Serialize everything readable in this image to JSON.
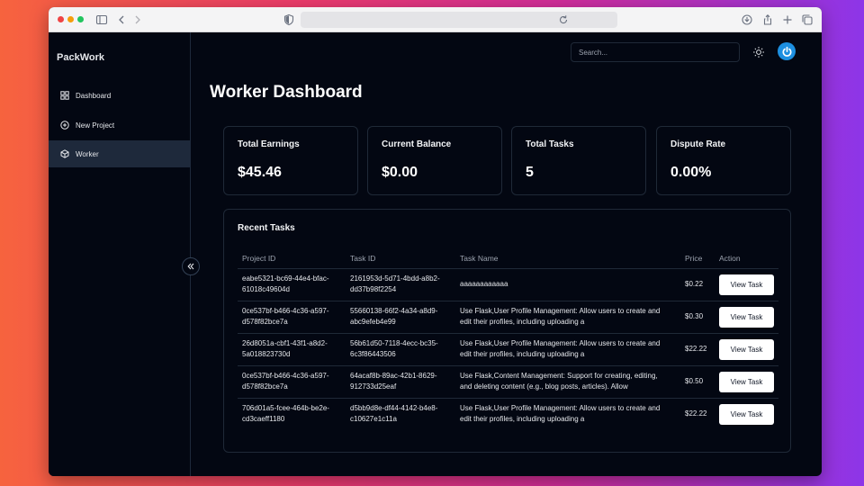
{
  "app": {
    "brand": "PackWork"
  },
  "browser": {
    "traffic_colors": [
      "#ef4444",
      "#f59e0b",
      "#22c55e"
    ],
    "url": ""
  },
  "sidebar": {
    "items": [
      {
        "label": "Dashboard",
        "icon": "grid-icon",
        "active": false
      },
      {
        "label": "New Project",
        "icon": "plus-circle-icon",
        "active": false
      },
      {
        "label": "Worker",
        "icon": "cube-icon",
        "active": true
      }
    ]
  },
  "header": {
    "search_placeholder": "Search...",
    "theme_icon": "sun-icon",
    "avatar_icon": "power-icon",
    "avatar_color": "#1d8fe0"
  },
  "main": {
    "title": "Worker Dashboard",
    "stats": [
      {
        "label": "Total Earnings",
        "value": "$45.46"
      },
      {
        "label": "Current Balance",
        "value": "$0.00"
      },
      {
        "label": "Total Tasks",
        "value": "5"
      },
      {
        "label": "Dispute Rate",
        "value": "0.00%"
      }
    ],
    "recent_tasks": {
      "title": "Recent Tasks",
      "columns": [
        "Project ID",
        "Task ID",
        "Task Name",
        "Price",
        "Action"
      ],
      "action_label": "View Task",
      "rows": [
        {
          "project_id": "eabe5321-bc69-44e4-bfac-61018c49604d",
          "task_id": "2161953d-5d71-4bdd-a8b2-dd37b98f2254",
          "task_name": "aaaaaaaaaaaa",
          "price": "$0.22"
        },
        {
          "project_id": "0ce537bf-b466-4c36-a597-d578f82bce7a",
          "task_id": "55660138-66f2-4a34-a8d9-abc9efeb4e99",
          "task_name": "Use Flask,User Profile Management: Allow users to create and edit their profiles, including uploading a",
          "price": "$0.30"
        },
        {
          "project_id": "26d8051a-cbf1-43f1-a8d2-5a018823730d",
          "task_id": "56b61d50-7118-4ecc-bc35-6c3f86443506",
          "task_name": "Use Flask,User Profile Management: Allow users to create and edit their profiles, including uploading a",
          "price": "$22.22"
        },
        {
          "project_id": "0ce537bf-b466-4c36-a597-d578f82bce7a",
          "task_id": "64acaf8b-89ac-42b1-8629-912733d25eaf",
          "task_name": "Use Flask,Content Management: Support for creating, editing, and deleting content (e.g., blog posts, articles). Allow",
          "price": "$0.50"
        },
        {
          "project_id": "706d01a5-fcee-464b-be2e-cd3caeff1180",
          "task_id": "d5bb9d8e-df44-4142-b4e8-c10627e1c11a",
          "task_name": "Use Flask,User Profile Management: Allow users to create and edit their profiles, including uploading a",
          "price": "$22.22"
        }
      ]
    }
  }
}
